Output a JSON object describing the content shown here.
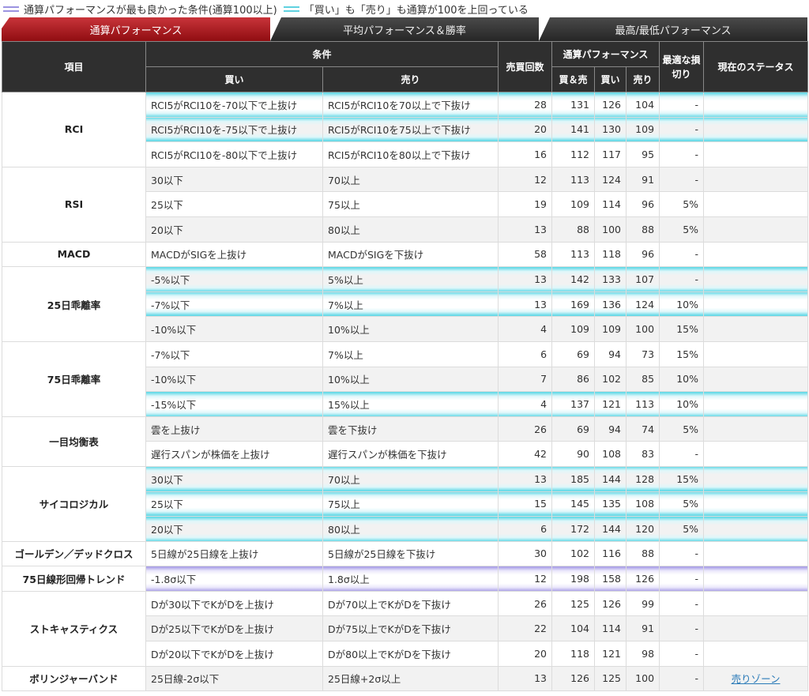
{
  "legend": {
    "purple": "通算パフォーマンスが最も良かった条件(通算100以上)",
    "cyan": "「買い」も「売り」も通算が100を上回っている"
  },
  "tabs": [
    {
      "label": "通算パフォーマンス",
      "active": true
    },
    {
      "label": "平均パフォーマンス＆勝率",
      "active": false
    },
    {
      "label": "最高/最低パフォーマンス",
      "active": false
    }
  ],
  "headers": {
    "item": "項目",
    "condition": "条件",
    "buy": "買い",
    "sell": "売り",
    "trades": "売買回数",
    "total_perf": "通算パフォーマンス",
    "both": "買＆売",
    "buy_short": "買い",
    "sell_short": "売り",
    "stoploss": "最適な損切り",
    "status": "現在のステータス"
  },
  "groups": [
    {
      "name": "RCI",
      "rows": [
        {
          "buy": "RCI5がRCI10を-70以下で上抜け",
          "sell": "RCI5がRCI10を70以上で下抜け",
          "trades": "28",
          "both": "131",
          "b": "126",
          "s": "104",
          "stop": "-",
          "status": "",
          "hl": "cyan"
        },
        {
          "buy": "RCI5がRCI10を-75以下で上抜け",
          "sell": "RCI5がRCI10を75以上で下抜け",
          "trades": "20",
          "both": "141",
          "b": "130",
          "s": "109",
          "stop": "-",
          "status": "",
          "hl": "cyan"
        },
        {
          "buy": "RCI5がRCI10を-80以下で上抜け",
          "sell": "RCI5がRCI10を80以上で下抜け",
          "trades": "16",
          "both": "112",
          "b": "117",
          "s": "95",
          "stop": "-",
          "status": "",
          "hl": ""
        }
      ]
    },
    {
      "name": "RSI",
      "rows": [
        {
          "buy": "30以下",
          "sell": "70以上",
          "trades": "12",
          "both": "113",
          "b": "124",
          "s": "91",
          "stop": "-",
          "status": "",
          "hl": ""
        },
        {
          "buy": "25以下",
          "sell": "75以上",
          "trades": "19",
          "both": "109",
          "b": "114",
          "s": "96",
          "stop": "5%",
          "status": "",
          "hl": ""
        },
        {
          "buy": "20以下",
          "sell": "80以上",
          "trades": "13",
          "both": "88",
          "b": "100",
          "s": "88",
          "stop": "5%",
          "status": "",
          "hl": ""
        }
      ]
    },
    {
      "name": "MACD",
      "rows": [
        {
          "buy": "MACDがSIGを上抜け",
          "sell": "MACDがSIGを下抜け",
          "trades": "58",
          "both": "113",
          "b": "118",
          "s": "96",
          "stop": "-",
          "status": "",
          "hl": ""
        }
      ]
    },
    {
      "name": "25日乖離率",
      "rows": [
        {
          "buy": "-5%以下",
          "sell": "5%以上",
          "trades": "13",
          "both": "142",
          "b": "133",
          "s": "107",
          "stop": "-",
          "status": "",
          "hl": "cyan"
        },
        {
          "buy": "-7%以下",
          "sell": "7%以上",
          "trades": "13",
          "both": "169",
          "b": "136",
          "s": "124",
          "stop": "10%",
          "status": "",
          "hl": "cyan"
        },
        {
          "buy": "-10%以下",
          "sell": "10%以上",
          "trades": "4",
          "both": "109",
          "b": "109",
          "s": "100",
          "stop": "15%",
          "status": "",
          "hl": ""
        }
      ]
    },
    {
      "name": "75日乖離率",
      "rows": [
        {
          "buy": "-7%以下",
          "sell": "7%以上",
          "trades": "6",
          "both": "69",
          "b": "94",
          "s": "73",
          "stop": "15%",
          "status": "",
          "hl": ""
        },
        {
          "buy": "-10%以下",
          "sell": "10%以上",
          "trades": "7",
          "both": "86",
          "b": "102",
          "s": "85",
          "stop": "10%",
          "status": "",
          "hl": ""
        },
        {
          "buy": "-15%以下",
          "sell": "15%以上",
          "trades": "4",
          "both": "137",
          "b": "121",
          "s": "113",
          "stop": "10%",
          "status": "",
          "hl": "cyan"
        }
      ]
    },
    {
      "name": "一目均衡表",
      "rows": [
        {
          "buy": "雲を上抜け",
          "sell": "雲を下抜け",
          "trades": "26",
          "both": "69",
          "b": "94",
          "s": "74",
          "stop": "5%",
          "status": "",
          "hl": ""
        },
        {
          "buy": "遅行スパンが株価を上抜け",
          "sell": "遅行スパンが株価を下抜け",
          "trades": "42",
          "both": "90",
          "b": "108",
          "s": "83",
          "stop": "-",
          "status": "",
          "hl": ""
        }
      ]
    },
    {
      "name": "サイコロジカル",
      "rows": [
        {
          "buy": "30以下",
          "sell": "70以上",
          "trades": "13",
          "both": "185",
          "b": "144",
          "s": "128",
          "stop": "15%",
          "status": "",
          "hl": "cyan"
        },
        {
          "buy": "25以下",
          "sell": "75以上",
          "trades": "15",
          "both": "145",
          "b": "135",
          "s": "108",
          "stop": "5%",
          "status": "",
          "hl": "cyan"
        },
        {
          "buy": "20以下",
          "sell": "80以上",
          "trades": "6",
          "both": "172",
          "b": "144",
          "s": "120",
          "stop": "5%",
          "status": "",
          "hl": "cyan"
        }
      ]
    },
    {
      "name": "ゴールデン／デッドクロス",
      "rows": [
        {
          "buy": "5日線が25日線を上抜け",
          "sell": "5日線が25日線を下抜け",
          "trades": "30",
          "both": "102",
          "b": "116",
          "s": "88",
          "stop": "-",
          "status": "",
          "hl": ""
        }
      ]
    },
    {
      "name": "75日線形回帰トレンド",
      "rows": [
        {
          "buy": "-1.8σ以下",
          "sell": "1.8σ以上",
          "trades": "12",
          "both": "198",
          "b": "158",
          "s": "126",
          "stop": "-",
          "status": "",
          "hl": "purple"
        }
      ]
    },
    {
      "name": "ストキャスティクス",
      "rows": [
        {
          "buy": "Dが30以下でKがDを上抜け",
          "sell": "Dが70以上でKがDを下抜け",
          "trades": "26",
          "both": "125",
          "b": "126",
          "s": "99",
          "stop": "-",
          "status": "",
          "hl": ""
        },
        {
          "buy": "Dが25以下でKがDを上抜け",
          "sell": "Dが75以上でKがDを下抜け",
          "trades": "22",
          "both": "104",
          "b": "114",
          "s": "91",
          "stop": "-",
          "status": "",
          "hl": ""
        },
        {
          "buy": "Dが20以下でKがDを上抜け",
          "sell": "Dが80以上でKがDを下抜け",
          "trades": "20",
          "both": "118",
          "b": "121",
          "s": "98",
          "stop": "-",
          "status": "",
          "hl": ""
        }
      ]
    },
    {
      "name": "ボリンジャーバンド",
      "rows": [
        {
          "buy": "25日線-2σ以下",
          "sell": "25日線+2σ以上",
          "trades": "13",
          "both": "126",
          "b": "125",
          "s": "100",
          "stop": "-",
          "status": "売りゾーン",
          "hl": ""
        }
      ]
    }
  ]
}
